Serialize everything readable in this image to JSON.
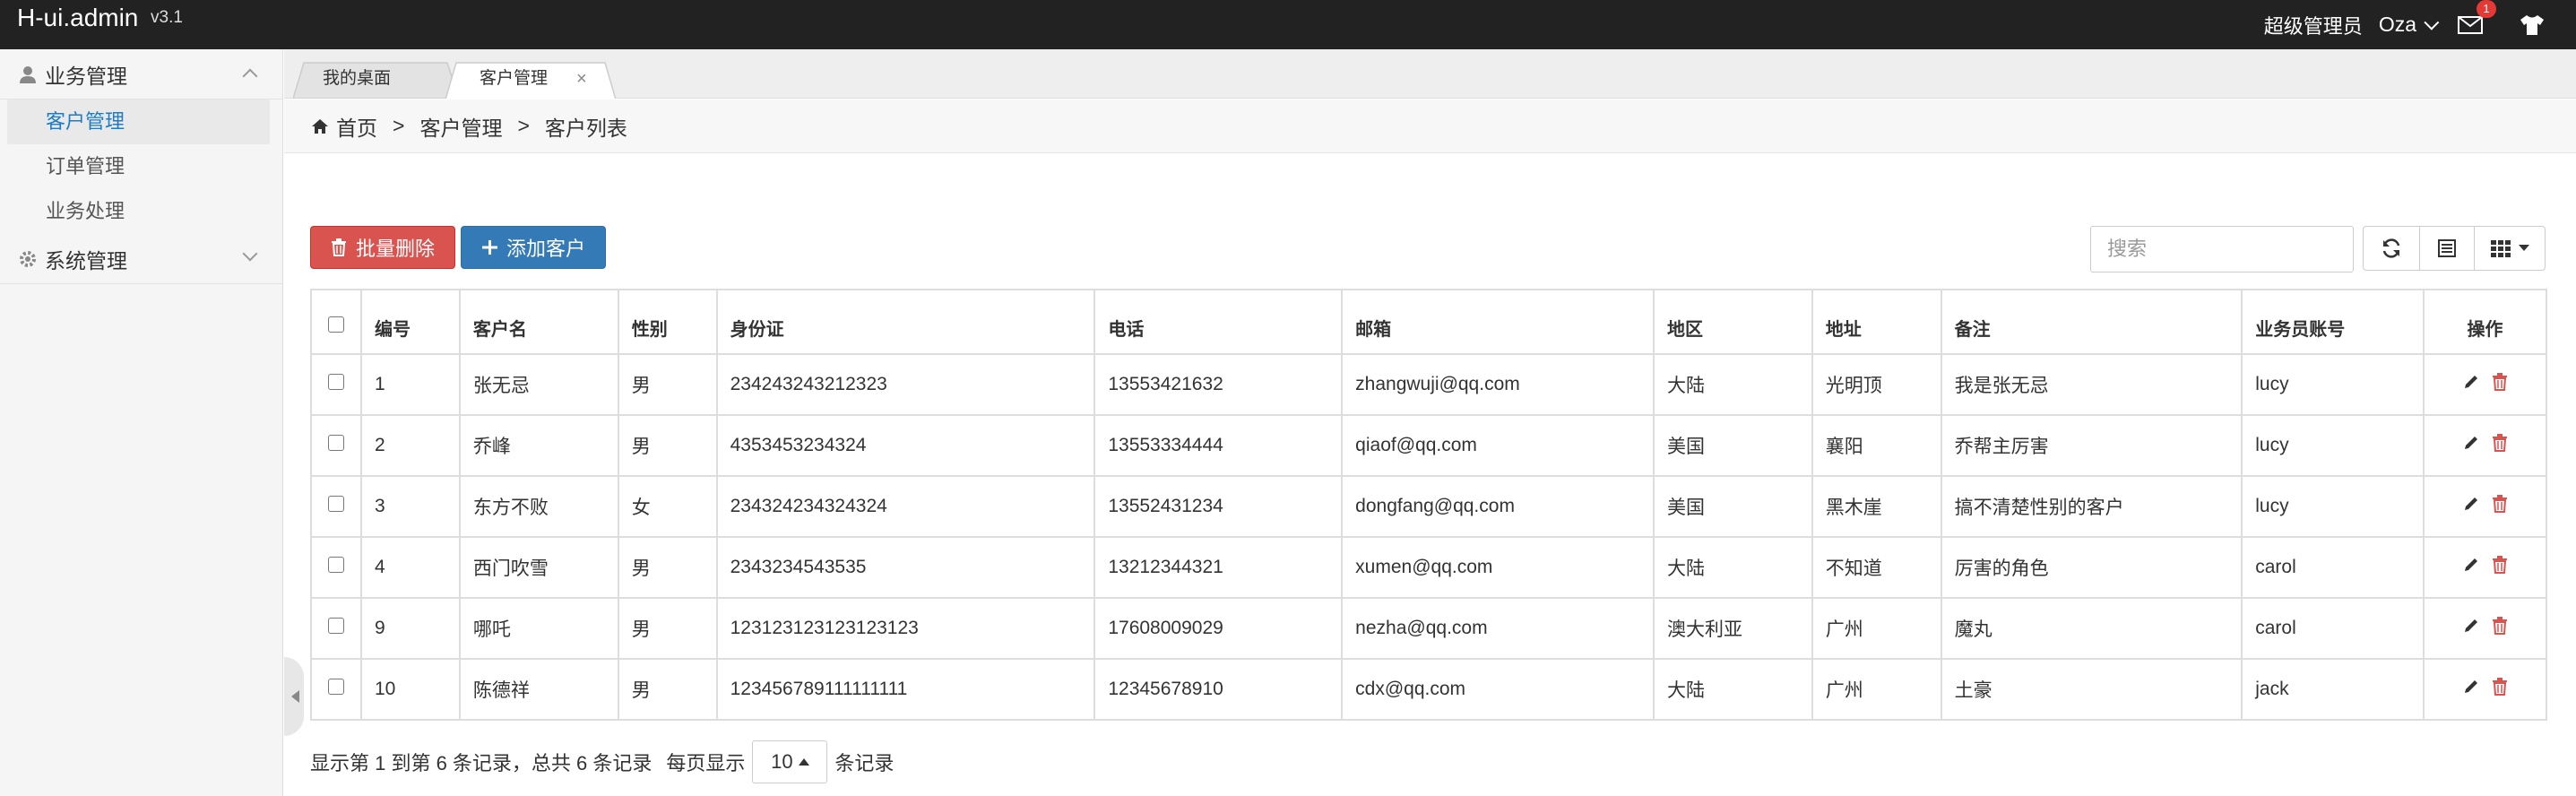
{
  "topbar": {
    "brand": "H-ui.admin",
    "version": "v3.1",
    "role": "超级管理员",
    "username": "Oza",
    "mail_badge": "1"
  },
  "sidebar": {
    "groups": [
      {
        "label": "业务管理",
        "items": [
          "客户管理",
          "订单管理",
          "业务处理"
        ]
      },
      {
        "label": "系统管理"
      }
    ]
  },
  "tabs": [
    {
      "label": "我的桌面"
    },
    {
      "label": "客户管理",
      "close": "×"
    }
  ],
  "breadcrumb": {
    "home": "首页",
    "sep": ">",
    "level1": "客户管理",
    "level2": "客户列表"
  },
  "toolbar": {
    "batch_delete": "批量删除",
    "add_customer": "添加客户",
    "search_placeholder": "搜索"
  },
  "table": {
    "headers": [
      "编号",
      "客户名",
      "性别",
      "身份证",
      "电话",
      "邮箱",
      "地区",
      "地址",
      "备注",
      "业务员账号",
      "操作"
    ],
    "rows": [
      [
        "1",
        "张无忌",
        "男",
        "234243243212323",
        "13553421632",
        "zhangwuji@qq.com",
        "大陆",
        "光明顶",
        "我是张无忌",
        "lucy"
      ],
      [
        "2",
        "乔峰",
        "男",
        "4353453234324",
        "13553334444",
        "qiaof@qq.com",
        "美国",
        "襄阳",
        "乔帮主厉害",
        "lucy"
      ],
      [
        "3",
        "东方不败",
        "女",
        "234324234324324",
        "13552431234",
        "dongfang@qq.com",
        "美国",
        "黑木崖",
        "搞不清楚性别的客户",
        "lucy"
      ],
      [
        "4",
        "西门吹雪",
        "男",
        "2343234543535",
        "13212344321",
        "xumen@qq.com",
        "大陆",
        "不知道",
        "厉害的角色",
        "carol"
      ],
      [
        "9",
        "哪吒",
        "男",
        "123123123123123123",
        "17608009029",
        "nezha@qq.com",
        "澳大利亚",
        "广州",
        "魔丸",
        "carol"
      ],
      [
        "10",
        "陈德祥",
        "男",
        "123456789111111111",
        "12345678910",
        "cdx@qq.com",
        "大陆",
        "广州",
        "土豪",
        "jack"
      ]
    ]
  },
  "pager": {
    "summary": "显示第 1 到第 6 条记录，总共 6 条记录",
    "per_page_prefix": "每页显示",
    "per_page": "10",
    "per_page_suffix": "条记录"
  },
  "colors": {
    "danger": "#d9534f",
    "primary": "#337ab7",
    "topbar": "#222222",
    "link": "#1e7bc4"
  }
}
